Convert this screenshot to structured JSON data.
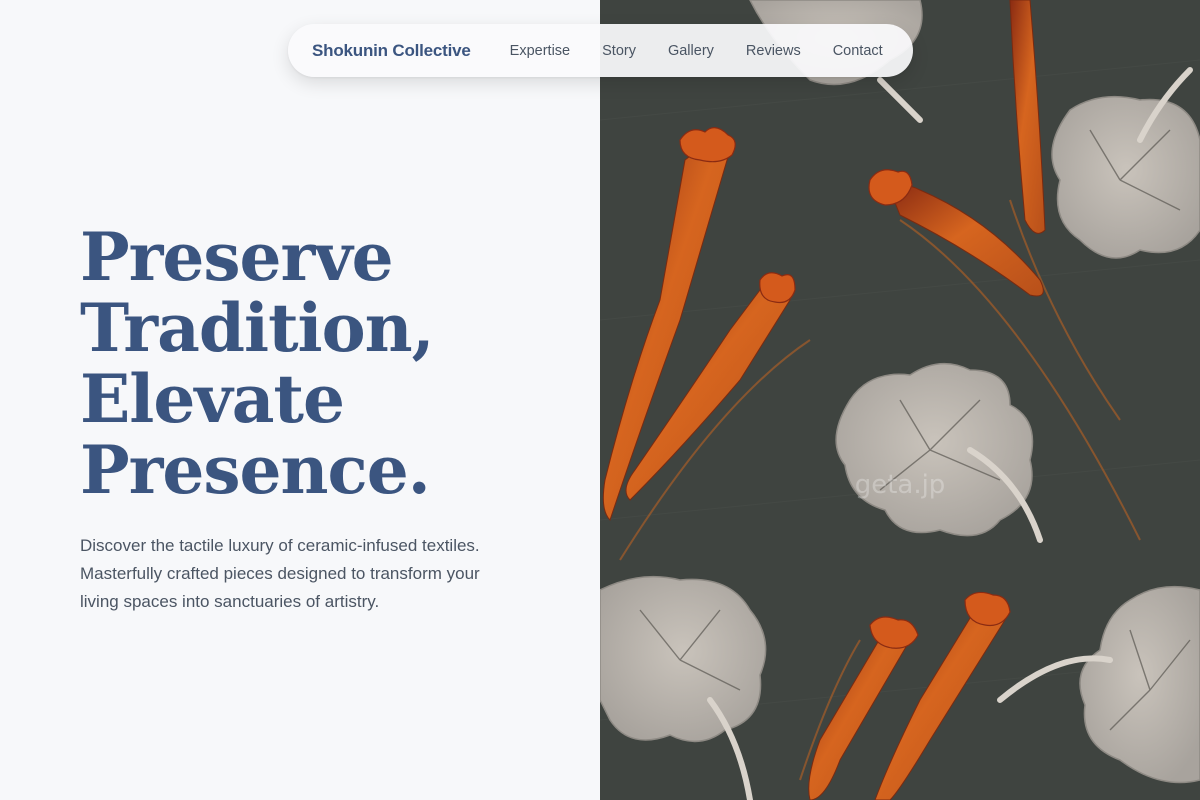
{
  "nav": {
    "brand": "Shokunin Collective",
    "links": [
      "Expertise",
      "Story",
      "Gallery",
      "Reviews",
      "Contact"
    ]
  },
  "hero": {
    "headline_lines": [
      "Preserve",
      "Tradition,",
      "Elevate",
      "Presence."
    ],
    "subtext": "Discover the tactile luxury of ceramic-infused textiles. Masterfully crafted pieces designed to transform your living spaces into sanctuaries of artistry."
  },
  "image": {
    "watermark": "geta.jp"
  },
  "colors": {
    "accent": "#3b5580",
    "background": "#f7f8fa",
    "body_text": "#4b5563",
    "fabric_dark": "#3f4440",
    "petal_orange": "#d4601e",
    "leaf_cream": "#d8cfc3"
  }
}
